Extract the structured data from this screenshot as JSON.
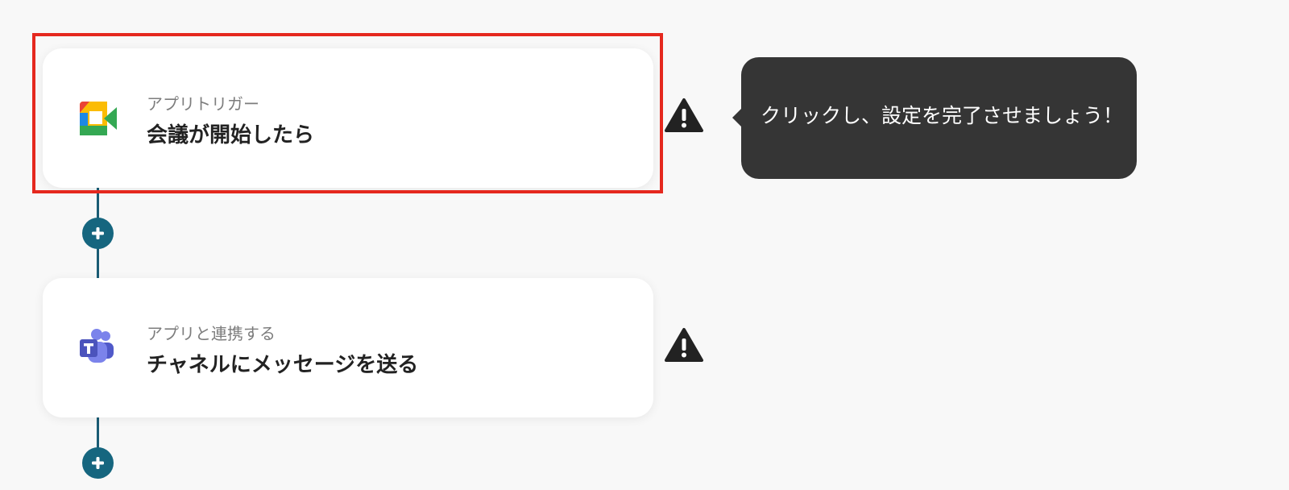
{
  "flow": {
    "steps": [
      {
        "kicker": "アプリトリガー",
        "title": "会議が開始したら",
        "app_icon": "google-meet-icon",
        "status_icon": "warning-icon",
        "highlighted": true
      },
      {
        "kicker": "アプリと連携する",
        "title": "チャネルにメッセージを送る",
        "app_icon": "microsoft-teams-icon",
        "status_icon": "warning-icon",
        "highlighted": false
      }
    ],
    "add_step_icon": "plus-icon"
  },
  "tooltip": {
    "text": "クリックし、設定を完了させましょう！"
  },
  "colors": {
    "background": "#f8f8f8",
    "connector": "#16667f",
    "highlight": "#e5281e",
    "tooltip_bg": "#353535",
    "warning": "#222222"
  }
}
